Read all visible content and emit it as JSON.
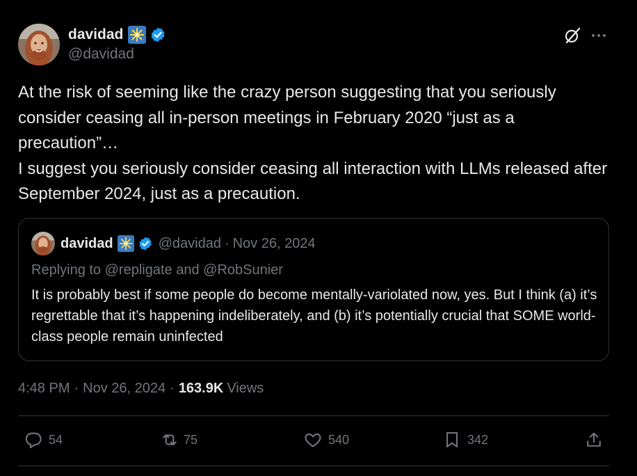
{
  "author": {
    "display_name": "davidad",
    "handle": "@davidad",
    "badge_icon": "sparkle-emoji-icon",
    "verified_color": "#1d9bf0"
  },
  "header_icons": {
    "grok": "grok-icon",
    "more": "more-icon"
  },
  "tweet_text": "At the risk of seeming like the crazy person suggesting that you seriously consider ceasing all in-person meetings in February 2020 “just as a precaution”…\nI suggest you seriously consider ceasing all interaction with LLMs released after September 2024, just as a precaution.",
  "quote": {
    "display_name": "davidad",
    "handle": "@davidad",
    "separator": "·",
    "date": "Nov 26, 2024",
    "replying": "Replying to @repligate and @RobSunier",
    "text": "It is probably best if some people do become mentally-variolated now, yes. But I think (a) it’s regrettable that it’s happening indeliberately, and (b) it’s potentially crucial that SOME world-class people remain uninfected"
  },
  "meta": {
    "time": "4:48 PM",
    "separator": "·",
    "date": "Nov 26, 2024",
    "views_count": "163.9K",
    "views_label": "Views"
  },
  "actions": {
    "replies": "54",
    "reposts": "75",
    "likes": "540",
    "bookmarks": "342"
  },
  "colors": {
    "background": "#000000",
    "text": "#e7e9ea",
    "secondary": "#71767b",
    "border": "#2f3336",
    "accent": "#1d9bf0"
  }
}
